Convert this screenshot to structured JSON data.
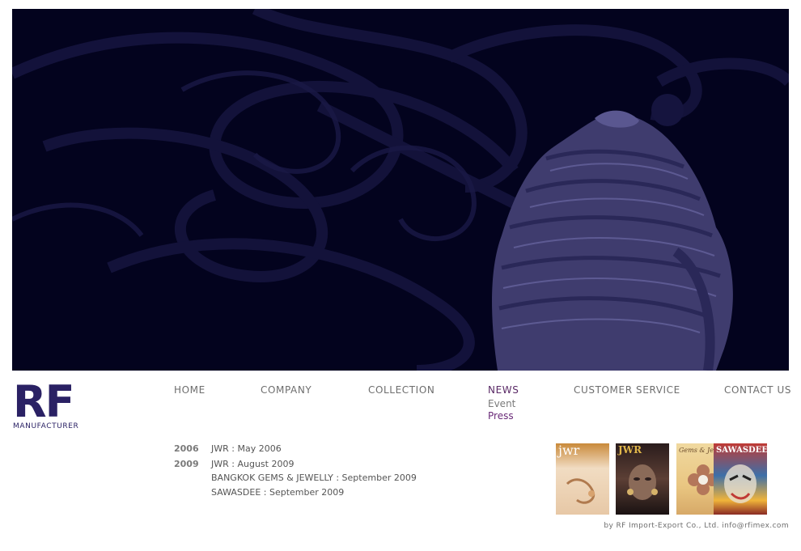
{
  "logo": {
    "mark": "RF",
    "subtitle": "MANUFACTURER",
    "color": "#2a2164"
  },
  "hero": {
    "background": "#03031e",
    "image": "ring-icon"
  },
  "nav": {
    "home": "HOME",
    "company": "COMPANY",
    "collection": "COLLECTION",
    "news": "NEWS",
    "customer_service": "CUSTOMER SERVICE",
    "contact_us": "CONTACT US",
    "active": "news",
    "active_color": "#5a2a66"
  },
  "subnav": {
    "event": "Event",
    "press": "Press",
    "active": "press"
  },
  "press": {
    "y2006": "2006",
    "y2006_entry": "JWR : May 2006",
    "y2009": "2009",
    "y2009_entries": [
      "JWR : August 2009",
      "BANGKOK GEMS & JEWELLY : September 2009",
      "SAWASDEE : September 2009"
    ]
  },
  "covers": [
    {
      "title": "jwr"
    },
    {
      "title": "JWR"
    },
    {
      "title": "Gems & Jewelry"
    },
    {
      "title": "SAWASDEE"
    }
  ],
  "footer": {
    "credit": "by RF Import-Export Co., Ltd.",
    "email": "info@rfimex.com"
  }
}
